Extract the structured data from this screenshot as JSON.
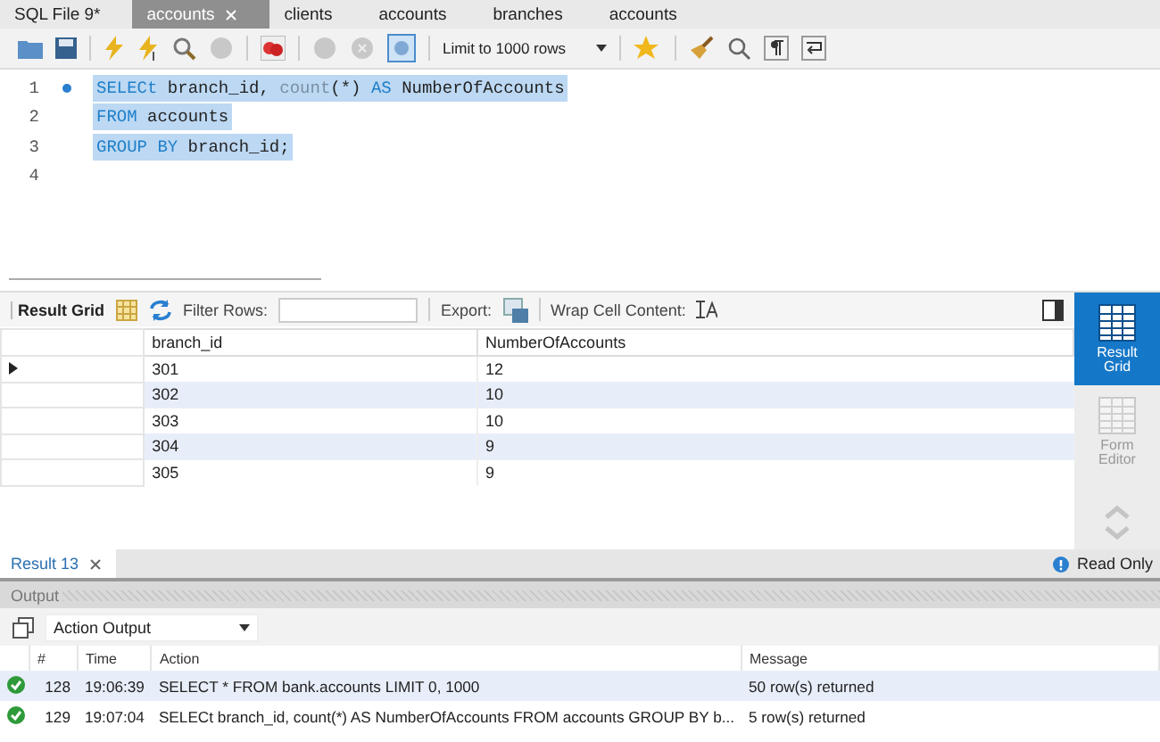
{
  "tabs": [
    {
      "label": "SQL File 9*",
      "selected": false,
      "closable": false
    },
    {
      "label": "accounts",
      "selected": true,
      "closable": true
    },
    {
      "label": "clients",
      "selected": false,
      "closable": false
    },
    {
      "label": "accounts",
      "selected": false,
      "closable": false
    },
    {
      "label": "branches",
      "selected": false,
      "closable": false
    },
    {
      "label": "accounts",
      "selected": false,
      "closable": false
    }
  ],
  "toolbar": {
    "limit": "Limit to 1000 rows",
    "toggle_on": true
  },
  "editor": {
    "lines": [
      {
        "number": "1",
        "marker": true,
        "selected": true,
        "tokens": [
          {
            "text": "SELECt",
            "kind": "keyword"
          },
          {
            "text": " branch_id, ",
            "kind": "plain"
          },
          {
            "text": "count",
            "kind": "function"
          },
          {
            "text": "(*) ",
            "kind": "plain"
          },
          {
            "text": "AS",
            "kind": "keyword"
          },
          {
            "text": " NumberOfAccounts",
            "kind": "plain"
          }
        ]
      },
      {
        "number": "2",
        "marker": false,
        "selected": true,
        "tokens": [
          {
            "text": "FROM",
            "kind": "keyword"
          },
          {
            "text": " accounts",
            "kind": "plain"
          }
        ]
      },
      {
        "number": "3",
        "marker": false,
        "selected": true,
        "tokens": [
          {
            "text": "GROUP BY",
            "kind": "keyword"
          },
          {
            "text": " branch_id;",
            "kind": "plain"
          }
        ]
      },
      {
        "number": "4",
        "marker": false,
        "selected": false
      }
    ]
  },
  "result_toolbar": {
    "title": "Result Grid",
    "filter_label": "Filter Rows:",
    "export_label": "Export:",
    "wrap_label": "Wrap Cell Content:"
  },
  "grid": {
    "columns": [
      "branch_id",
      "NumberOfAccounts"
    ],
    "rows": [
      {
        "cells": [
          "301",
          "12"
        ],
        "selected": true
      },
      {
        "cells": [
          "302",
          "10"
        ],
        "selected": false
      },
      {
        "cells": [
          "303",
          "10"
        ],
        "selected": false
      },
      {
        "cells": [
          "304",
          "9"
        ],
        "selected": false
      },
      {
        "cells": [
          "305",
          "9"
        ],
        "selected": false
      }
    ]
  },
  "side_panel": [
    {
      "label": "Result Grid",
      "selected": true
    },
    {
      "label": "Form Editor",
      "selected": false
    }
  ],
  "result_tab": {
    "label": "Result 13",
    "status": "Read Only"
  },
  "output": {
    "title": "Output",
    "selector": "Action Output",
    "columns": [
      "#",
      "Time",
      "Action",
      "Message"
    ],
    "rows": [
      {
        "number": "128",
        "time": "19:06:39",
        "action": "SELECT * FROM bank.accounts LIMIT 0, 1000",
        "message": "50 row(s) returned"
      },
      {
        "number": "129",
        "time": "19:07:04",
        "action": "SELECt branch_id, count(*) AS NumberOfAccounts FROM accounts GROUP BY b...",
        "message": "5 row(s) returned"
      }
    ]
  }
}
